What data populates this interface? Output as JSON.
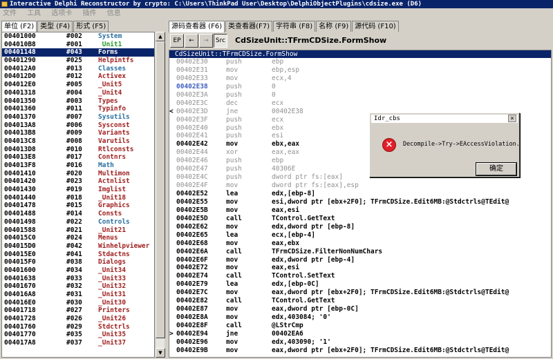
{
  "window": {
    "title": "Interactive Delphi Reconstructor by crypto: C:\\Users\\ThinkPad User\\Desktop\\DelphiObjectPlugins\\cdsize.exe (D6)"
  },
  "menu": [
    "文件",
    "工具",
    "选项卡",
    "插件",
    "信息"
  ],
  "left_tabs": [
    "单位 (F2)",
    "类型 (F4)",
    "形式 (F5)"
  ],
  "units": [
    {
      "addr": "00401000",
      "num": "#002",
      "name": "System",
      "color": "#2a6fa0"
    },
    {
      "addr": "004010B8",
      "num": "#001",
      "name": " Unit1",
      "color": "#2a9a2a"
    },
    {
      "addr": "00401148",
      "num": "#043",
      "name": "Forms",
      "color": "#ffffff",
      "selected": true
    },
    {
      "addr": "00401290",
      "num": "#025",
      "name": "Helpintfs",
      "color": "#a02020"
    },
    {
      "addr": "004012A0",
      "num": "#013",
      "name": "Classes",
      "color": "#2a6fa0"
    },
    {
      "addr": "004012D0",
      "num": "#012",
      "name": "Activex",
      "color": "#a02020"
    },
    {
      "addr": "004012E0",
      "num": "#005",
      "name": "_Unit5",
      "color": "#a02020"
    },
    {
      "addr": "00401318",
      "num": "#004",
      "name": "_Unit4",
      "color": "#a02020"
    },
    {
      "addr": "00401350",
      "num": "#003",
      "name": "Types",
      "color": "#a02020"
    },
    {
      "addr": "00401360",
      "num": "#011",
      "name": "Typinfo",
      "color": "#a02020"
    },
    {
      "addr": "00401370",
      "num": "#007",
      "name": "Sysutils",
      "color": "#2a6fa0"
    },
    {
      "addr": "004013A8",
      "num": "#006",
      "name": "Sysconst",
      "color": "#a02020"
    },
    {
      "addr": "004013B8",
      "num": "#009",
      "name": "Variants",
      "color": "#a02020"
    },
    {
      "addr": "004013C8",
      "num": "#008",
      "name": "Varutils",
      "color": "#a02020"
    },
    {
      "addr": "004013D8",
      "num": "#010",
      "name": "Rtlconsts",
      "color": "#a02020"
    },
    {
      "addr": "004013E8",
      "num": "#017",
      "name": "Contnrs",
      "color": "#a02020"
    },
    {
      "addr": "004013F8",
      "num": "#016",
      "name": "Math",
      "color": "#2a6fa0"
    },
    {
      "addr": "00401410",
      "num": "#020",
      "name": "Multimon",
      "color": "#a02020"
    },
    {
      "addr": "00401420",
      "num": "#023",
      "name": "Actnlist",
      "color": "#a02020"
    },
    {
      "addr": "00401430",
      "num": "#019",
      "name": "Imglist",
      "color": "#a02020"
    },
    {
      "addr": "00401440",
      "num": "#018",
      "name": "_Unit18",
      "color": "#a02020"
    },
    {
      "addr": "00401478",
      "num": "#015",
      "name": "Graphics",
      "color": "#a02020"
    },
    {
      "addr": "00401488",
      "num": "#014",
      "name": "Consts",
      "color": "#a02020"
    },
    {
      "addr": "00401498",
      "num": "#022",
      "name": "Controls",
      "color": "#2a6fa0"
    },
    {
      "addr": "00401588",
      "num": "#021",
      "name": "_Unit21",
      "color": "#a02020"
    },
    {
      "addr": "004015C0",
      "num": "#024",
      "name": "Menus",
      "color": "#a02020"
    },
    {
      "addr": "004015D0",
      "num": "#042",
      "name": "Winhelpviewer",
      "color": "#a02020"
    },
    {
      "addr": "004015E0",
      "num": "#041",
      "name": "Stdactns",
      "color": "#a02020"
    },
    {
      "addr": "004015F0",
      "num": "#038",
      "name": "Dialogs",
      "color": "#a02020"
    },
    {
      "addr": "00401600",
      "num": "#034",
      "name": "_Unit34",
      "color": "#a02020"
    },
    {
      "addr": "00401638",
      "num": "#033",
      "name": "_Unit33",
      "color": "#a02020"
    },
    {
      "addr": "00401670",
      "num": "#032",
      "name": "_Unit32",
      "color": "#a02020"
    },
    {
      "addr": "004016A8",
      "num": "#031",
      "name": "_Unit31",
      "color": "#a02020"
    },
    {
      "addr": "004016E0",
      "num": "#030",
      "name": "_Unit30",
      "color": "#a02020"
    },
    {
      "addr": "00401718",
      "num": "#027",
      "name": "Printers",
      "color": "#a02020"
    },
    {
      "addr": "00401728",
      "num": "#026",
      "name": "_Unit26",
      "color": "#a02020"
    },
    {
      "addr": "00401760",
      "num": "#029",
      "name": "Stdctrls",
      "color": "#a02020"
    },
    {
      "addr": "00401770",
      "num": "#035",
      "name": "_Unit35",
      "color": "#a02020"
    },
    {
      "addr": "004017A8",
      "num": "#037",
      "name": "_Unit37",
      "color": "#a02020"
    }
  ],
  "right_tabs": [
    "源码查看器 (F6)",
    "类查看器(F7)",
    "字符串 (F8)",
    "名称 (F9)",
    "源代码 (F10)"
  ],
  "toolbar": {
    "ep": "EP",
    "back": "←",
    "forward": "→",
    "src": "Src",
    "proc_title": "CdSizeUnit::TFrmCDSize.FormShow"
  },
  "code_header": "CdSizeUnit::TFrmCDSize.FormShow",
  "code": [
    {
      "mark": "",
      "addr": "00402E30",
      "mn": "push",
      "op": "ebp",
      "active": false
    },
    {
      "mark": "",
      "addr": "00402E31",
      "mn": "mov",
      "op": "ebp,esp",
      "active": false
    },
    {
      "mark": "",
      "addr": "00402E33",
      "mn": "mov",
      "op": "ecx,4",
      "active": false
    },
    {
      "mark": "",
      "addr": "00402E38",
      "mn": "push",
      "op": "0",
      "active": false,
      "target": true
    },
    {
      "mark": "",
      "addr": "00402E3A",
      "mn": "push",
      "op": "0",
      "active": false
    },
    {
      "mark": "",
      "addr": "00402E3C",
      "mn": "dec",
      "op": "ecx",
      "active": false
    },
    {
      "mark": "<",
      "addr": "00402E3D",
      "mn": "jne",
      "op": "00402E38",
      "active": false
    },
    {
      "mark": "",
      "addr": "00402E3F",
      "mn": "push",
      "op": "ecx",
      "active": false
    },
    {
      "mark": "",
      "addr": "00402E40",
      "mn": "push",
      "op": "ebx",
      "active": false
    },
    {
      "mark": "",
      "addr": "00402E41",
      "mn": "push",
      "op": "esi",
      "active": false
    },
    {
      "mark": "",
      "addr": "00402E42",
      "mn": "mov",
      "op": "ebx,eax",
      "active": true
    },
    {
      "mark": "",
      "addr": "00402E44",
      "mn": "xor",
      "op": "eax,eax",
      "active": false
    },
    {
      "mark": "",
      "addr": "00402E46",
      "mn": "push",
      "op": "ebp",
      "active": false
    },
    {
      "mark": "",
      "addr": "00402E47",
      "mn": "push",
      "op": "40306E",
      "active": false
    },
    {
      "mark": "",
      "addr": "00402E4C",
      "mn": "push",
      "op": "dword ptr fs:[eax]",
      "active": false
    },
    {
      "mark": "",
      "addr": "00402E4F",
      "mn": "mov",
      "op": "dword ptr fs:[eax],esp",
      "active": false
    },
    {
      "mark": "",
      "addr": "00402E52",
      "mn": "lea",
      "op": "edx,[ebp-8]",
      "active": true
    },
    {
      "mark": "",
      "addr": "00402E55",
      "mn": "mov",
      "op": "esi,dword ptr [ebx+2F0]; TFrmCDSize.Edit6MB:@Stdctrls@TEdit@",
      "active": true
    },
    {
      "mark": "",
      "addr": "00402E5B",
      "mn": "mov",
      "op": "eax,esi",
      "active": true
    },
    {
      "mark": "",
      "addr": "00402E5D",
      "mn": "call",
      "op": "TControl.GetText",
      "active": true
    },
    {
      "mark": "",
      "addr": "00402E62",
      "mn": "mov",
      "op": "edx,dword ptr [ebp-8]",
      "active": true
    },
    {
      "mark": "",
      "addr": "00402E65",
      "mn": "lea",
      "op": "ecx,[ebp-4]",
      "active": true
    },
    {
      "mark": "",
      "addr": "00402E68",
      "mn": "mov",
      "op": "eax,ebx",
      "active": true
    },
    {
      "mark": "",
      "addr": "00402E6A",
      "mn": "call",
      "op": "TFrmCDSize.FilterNonNumChars",
      "active": true
    },
    {
      "mark": "",
      "addr": "00402E6F",
      "mn": "mov",
      "op": "edx,dword ptr [ebp-4]",
      "active": true
    },
    {
      "mark": "",
      "addr": "00402E72",
      "mn": "mov",
      "op": "eax,esi",
      "active": true
    },
    {
      "mark": "",
      "addr": "00402E74",
      "mn": "call",
      "op": "TControl.SetText",
      "active": true
    },
    {
      "mark": "",
      "addr": "00402E79",
      "mn": "lea",
      "op": "edx,[ebp-0C]",
      "active": true
    },
    {
      "mark": "",
      "addr": "00402E7C",
      "mn": "mov",
      "op": "eax,dword ptr [ebx+2F0]; TFrmCDSize.Edit6MB:@Stdctrls@TEdit@",
      "active": true
    },
    {
      "mark": "",
      "addr": "00402E82",
      "mn": "call",
      "op": "TControl.GetText",
      "active": true
    },
    {
      "mark": "",
      "addr": "00402E87",
      "mn": "mov",
      "op": "eax,dword ptr [ebp-0C]",
      "active": true
    },
    {
      "mark": "",
      "addr": "00402E8A",
      "mn": "mov",
      "op": "edx,403084; '0'",
      "active": true
    },
    {
      "mark": "",
      "addr": "00402E8F",
      "mn": "call",
      "op": "@LStrCmp",
      "active": true
    },
    {
      "mark": ">",
      "addr": "00402E94",
      "mn": "jne",
      "op": "00402EA6",
      "active": true
    },
    {
      "mark": "",
      "addr": "00402E96",
      "mn": "mov",
      "op": "edx,403090; '1'",
      "active": true
    },
    {
      "mark": "",
      "addr": "00402E9B",
      "mn": "mov",
      "op": "eax,dword ptr [ebx+2F0]; TFrmCDSize.Edit6MB:@Stdctrls@TEdit@",
      "active": true
    }
  ],
  "dialog": {
    "title": "Idr_cbs",
    "close": "×",
    "icon": "×",
    "message": "Decompile->Try->EAccessViolation.",
    "ok": "确定"
  }
}
